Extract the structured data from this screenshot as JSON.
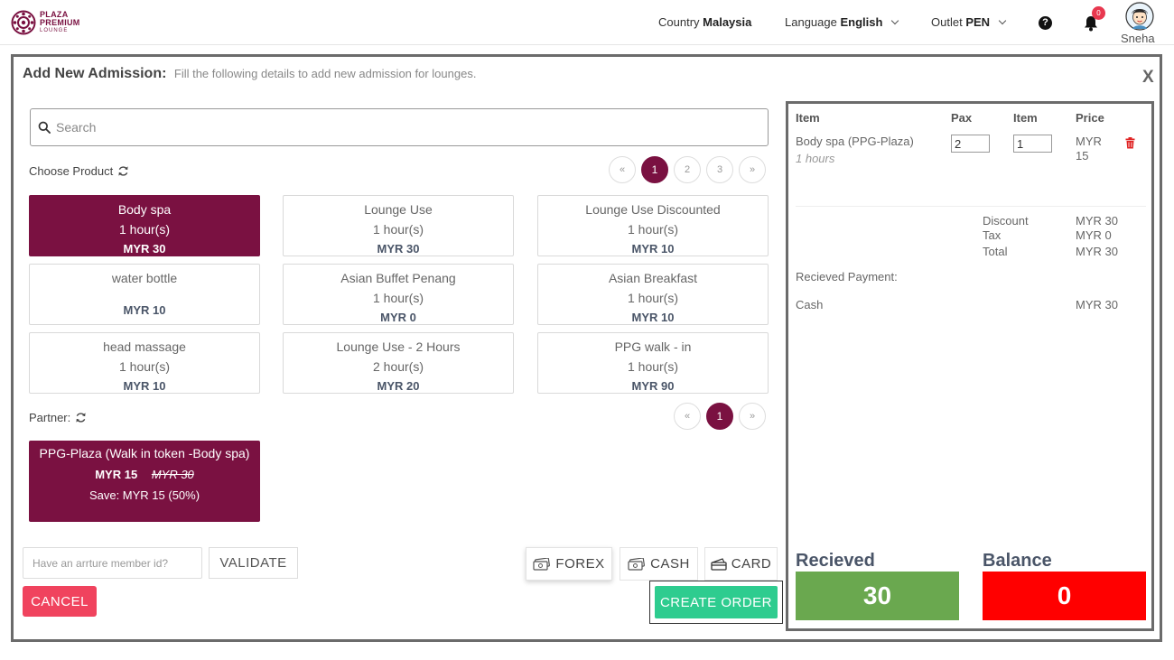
{
  "header": {
    "logo_line1": "PLAZA",
    "logo_line2": "PREMIUM",
    "logo_line3": "LOUNGE",
    "country_label": "Country",
    "country_value": "Malaysia",
    "language_label": "Language",
    "language_value": "English",
    "outlet_label": "Outlet",
    "outlet_value": "PEN",
    "notification_count": "0",
    "user_name": "Sneha"
  },
  "modal": {
    "title": "Add New Admission:",
    "description": "Fill the following details to add new admission for lounges.",
    "close_label": "X",
    "search_placeholder": "Search",
    "choose_product_label": "Choose Product",
    "product_pages": [
      "«",
      "1",
      "2",
      "3",
      "»"
    ],
    "products": [
      {
        "name": "Body spa",
        "duration": "1 hour(s)",
        "price": "MYR 30",
        "selected": true
      },
      {
        "name": "Lounge Use",
        "duration": "1 hour(s)",
        "price": "MYR 30",
        "selected": false
      },
      {
        "name": "Lounge Use Discounted",
        "duration": "1 hour(s)",
        "price": "MYR 10",
        "selected": false
      },
      {
        "name": "water bottle",
        "duration": "",
        "price": "MYR 10",
        "selected": false
      },
      {
        "name": "Asian Buffet Penang",
        "duration": "1 hour(s)",
        "price": "MYR 0",
        "selected": false
      },
      {
        "name": "Asian Breakfast",
        "duration": "1 hour(s)",
        "price": "MYR 10",
        "selected": false
      },
      {
        "name": "head massage",
        "duration": "1 hour(s)",
        "price": "MYR 10",
        "selected": false
      },
      {
        "name": "Lounge Use - 2 Hours",
        "duration": "2 hour(s)",
        "price": "MYR 20",
        "selected": false
      },
      {
        "name": "PPG walk - in",
        "duration": "1 hour(s)",
        "price": "MYR 90",
        "selected": false
      }
    ],
    "partner_label": "Partner:",
    "partner_pages": [
      "«",
      "1",
      "»"
    ],
    "partner": {
      "name": "PPG-Plaza (Walk in token -Body spa)",
      "price": "MYR 15",
      "original_price": "MYR 30",
      "save": "Save: MYR 15 (50%)"
    },
    "member_placeholder": "Have an arrture member id?",
    "validate_label": "VALIDATE",
    "forex_label": "FOREX",
    "cash_label": "CASH",
    "card_label": "CARD",
    "cancel_label": "CANCEL",
    "create_order_label": "CREATE ORDER"
  },
  "order": {
    "col_item": "Item",
    "col_pax": "Pax",
    "col_item_qty": "Item",
    "col_price": "Price",
    "line_item": {
      "name": "Body spa (PPG-Plaza)",
      "duration": "1 hours",
      "pax": "2",
      "qty": "1",
      "price_line1": "MYR",
      "price_line2": "15"
    },
    "discount_label": "Discount",
    "discount_value": "MYR 30",
    "tax_label": "Tax",
    "tax_value": "MYR 0",
    "total_label": "Total",
    "total_value": "MYR 30",
    "received_payment_label": "Recieved Payment:",
    "payment_method": "Cash",
    "payment_amount": "MYR 30",
    "received_label": "Recieved",
    "received_value": "30",
    "balance_label": "Balance",
    "balance_value": "0"
  },
  "colors": {
    "brand": "#7a1141",
    "received_box": "#6aa84f",
    "balance_box": "#ff0000",
    "create_order": "#2ecc8f",
    "cancel": "#f0435e"
  }
}
